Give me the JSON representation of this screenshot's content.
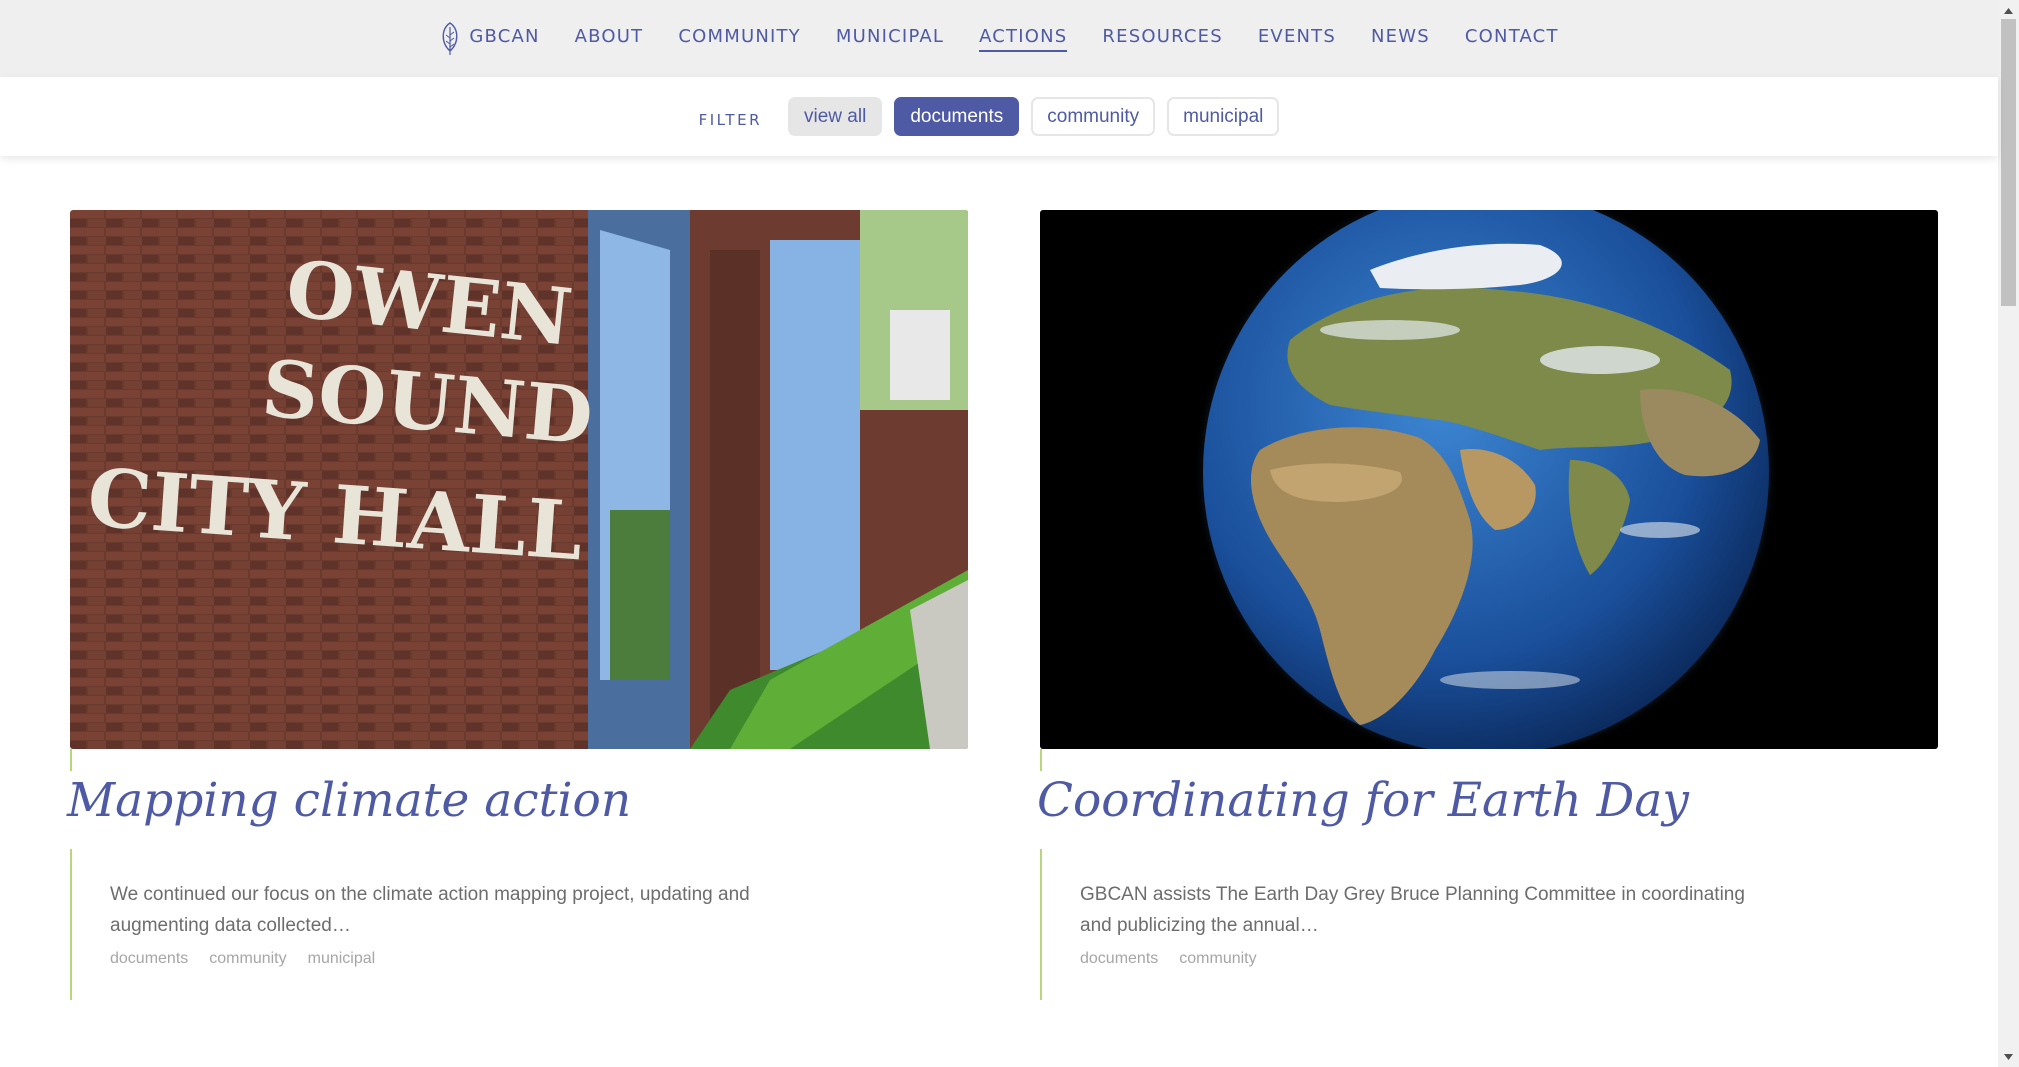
{
  "nav": {
    "brand_label": "GBCAN",
    "brand_icon": "leaf-icon",
    "items": [
      {
        "label": "ABOUT",
        "active": false
      },
      {
        "label": "COMMUNITY",
        "active": false
      },
      {
        "label": "MUNICIPAL",
        "active": false
      },
      {
        "label": "ACTIONS",
        "active": true
      },
      {
        "label": "RESOURCES",
        "active": false
      },
      {
        "label": "EVENTS",
        "active": false
      },
      {
        "label": "NEWS",
        "active": false
      },
      {
        "label": "CONTACT",
        "active": false
      }
    ]
  },
  "filter": {
    "label": "FILTER",
    "options": [
      {
        "label": "view all",
        "state": "grey"
      },
      {
        "label": "documents",
        "state": "active"
      },
      {
        "label": "community",
        "state": "outline"
      },
      {
        "label": "municipal",
        "state": "outline"
      }
    ]
  },
  "cards": [
    {
      "image_sign_text": [
        "OWEN",
        "SOUND",
        "CITY HALL"
      ],
      "title": "Mapping climate action",
      "excerpt_line1": "We continued our focus on the climate action mapping project, updating and",
      "excerpt_line2": "augmenting data collected…",
      "tags": [
        "documents",
        "community",
        "municipal"
      ]
    },
    {
      "title": "Coordinating for Earth Day",
      "excerpt_line1": "GBCAN assists The Earth Day Grey Bruce Planning Committee in coordinating",
      "excerpt_line2": "and publicizing the annual…",
      "tags": [
        "documents",
        "community"
      ]
    }
  ],
  "colors": {
    "brand": "#4f5aa4",
    "accent_line": "#b7d77a",
    "nav_bg": "#efefef",
    "chip_grey": "#e6e6e6",
    "excerpt_text": "#6d6d6d",
    "tag_text": "#a6a6a6"
  }
}
